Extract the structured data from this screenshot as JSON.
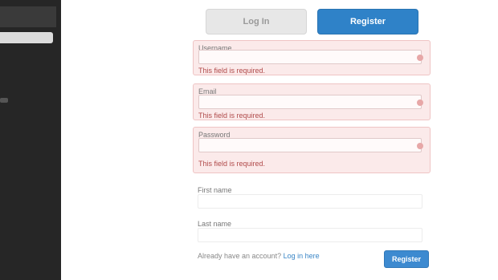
{
  "tabs": {
    "login": "Log In",
    "register": "Register"
  },
  "form": {
    "username": {
      "label": "Username",
      "value": "",
      "error": "This field is required."
    },
    "email": {
      "label": "Email",
      "value": "",
      "error": "This field is required."
    },
    "password": {
      "label": "Password",
      "value": "",
      "error": "This field is required."
    },
    "first_name": {
      "label": "First name",
      "value": ""
    },
    "last_name": {
      "label": "Last name",
      "value": ""
    }
  },
  "footer": {
    "text": "Already have an account?",
    "link": "Log in here"
  },
  "submit_label": "Register",
  "colors": {
    "accent": "#2f82c8",
    "error_bg": "#fbeaea",
    "sidebar": "#262626"
  }
}
